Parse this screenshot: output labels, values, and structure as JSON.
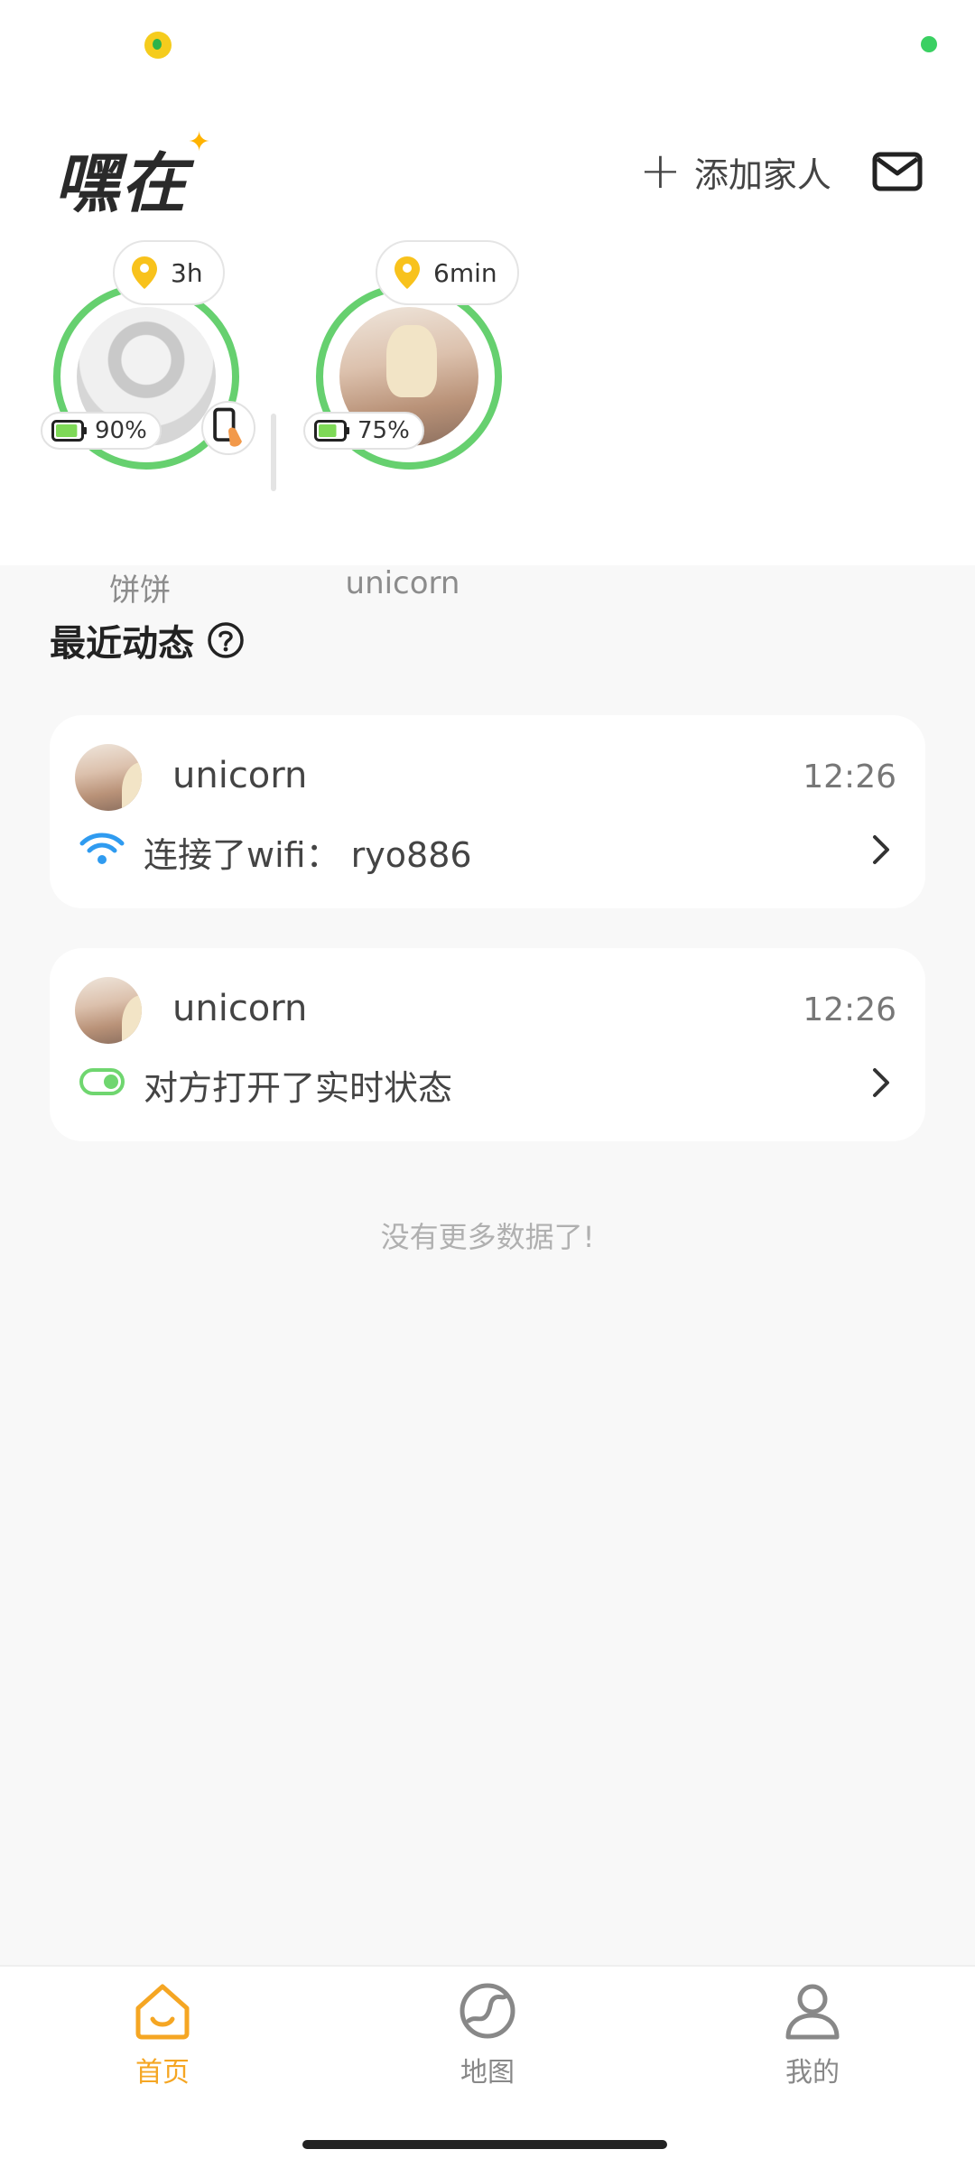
{
  "header": {
    "app_title": "嘿在",
    "add_family_label": "添加家人"
  },
  "members": [
    {
      "name": "饼饼",
      "last_seen": "3h",
      "battery": "90%",
      "battery_level": 0.9
    },
    {
      "name": "unicorn",
      "last_seen": "6min",
      "battery": "75%",
      "battery_level": 0.75
    }
  ],
  "recent": {
    "title": "最近动态",
    "items": [
      {
        "user": "unicorn",
        "time": "12:26",
        "event": "连接了wifi： ryo886",
        "icon": "wifi-icon"
      },
      {
        "user": "unicorn",
        "time": "12:26",
        "event": "对方打开了实时状态",
        "icon": "toggle-on-icon"
      }
    ],
    "no_more": "没有更多数据了!"
  },
  "nav": {
    "home": "首页",
    "map": "地图",
    "mine": "我的"
  },
  "colors": {
    "accent": "#f5a623",
    "ring_green": "#66d06f",
    "pin_yellow": "#f8c21c",
    "wifi_blue": "#2f9bf0",
    "toggle_green": "#6fd66f"
  }
}
